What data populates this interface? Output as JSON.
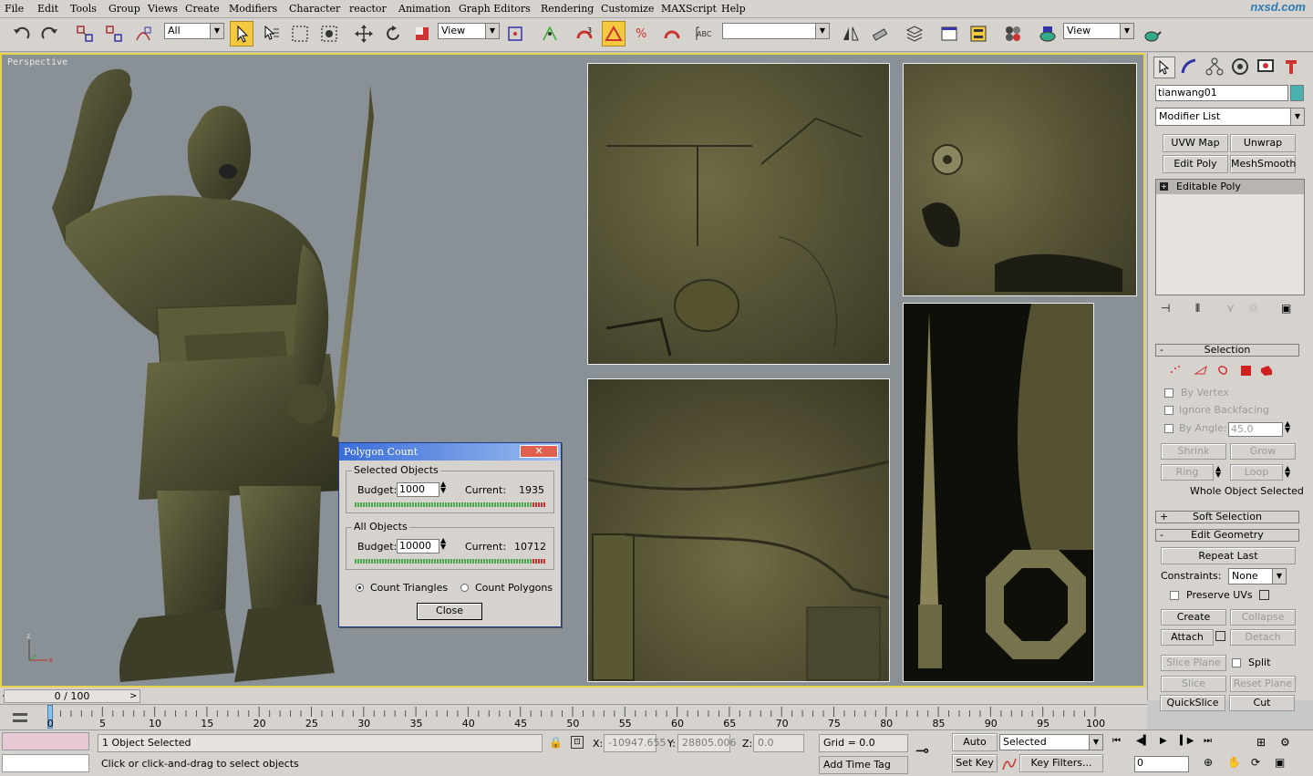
{
  "menu": [
    "File",
    "Edit",
    "Tools",
    "Group",
    "Views",
    "Create",
    "Modifiers",
    "Character",
    "reactor",
    "Animation",
    "Graph Editors",
    "Rendering",
    "Customize",
    "MAXScript",
    "Help"
  ],
  "logo": "nxsd.com",
  "toolbar": {
    "selection_filter": "All",
    "ref_coord": "View",
    "named_selection": "",
    "render_view": "View"
  },
  "viewport": {
    "label": "Perspective",
    "axis_x": "x",
    "axis_z": "z"
  },
  "polygon_dialog": {
    "title": "Polygon Count",
    "close_x": "✕",
    "selected": {
      "title": "Selected Objects",
      "budget_label": "Budget:",
      "budget": "1000",
      "current_label": "Current:",
      "current": "1935"
    },
    "all": {
      "title": "All Objects",
      "budget_label": "Budget:",
      "budget": "10000",
      "current_label": "Current:",
      "current": "10712"
    },
    "count_triangles": "Count Triangles",
    "count_polygons": "Count Polygons",
    "close_button": "Close"
  },
  "panel": {
    "object_name": "tianwang01",
    "modifier_list": "Modifier List",
    "mod_buttons": [
      "UVW Map",
      "Unwrap UVW",
      "Edit Poly",
      "MeshSmooth"
    ],
    "stack_item": "Editable Poly",
    "selection_title": "Selection",
    "by_vertex": "By Vertex",
    "ignore_backfacing": "Ignore Backfacing",
    "by_angle": "By Angle:",
    "angle_value": "45.0",
    "shrink": "Shrink",
    "grow": "Grow",
    "ring": "Ring",
    "loop": "Loop",
    "whole_object": "Whole Object Selected",
    "soft_selection": "Soft Selection",
    "edit_geometry": "Edit Geometry",
    "repeat_last": "Repeat Last",
    "constraints": "Constraints:",
    "constraints_value": "None",
    "preserve_uvs": "Preserve UVs",
    "create": "Create",
    "collapse": "Collapse",
    "attach": "Attach",
    "detach": "Detach",
    "slice_plane": "Slice Plane",
    "split": "Split",
    "slice": "Slice",
    "reset_plane": "Reset Plane",
    "quickslice": "QuickSlice",
    "cut": "Cut"
  },
  "timeline": {
    "slider": "0 / 100",
    "ticks": [
      "0",
      "5",
      "10",
      "15",
      "20",
      "25",
      "30",
      "35",
      "40",
      "45",
      "50",
      "55",
      "60",
      "65",
      "70",
      "75",
      "80",
      "85",
      "90",
      "95",
      "100"
    ]
  },
  "status": {
    "objects_selected": "1 Object Selected",
    "prompt": "Click or click-and-drag to select objects",
    "x_label": "X:",
    "x_value": "-10947.655",
    "y_label": "Y:",
    "y_value": "28805.006",
    "z_label": "Z:",
    "z_value": "0.0",
    "grid": "Grid = 0.0",
    "add_time_tag": "Add Time Tag",
    "auto_key": "Auto Key",
    "set_key": "Set Key",
    "key_mode": "Selected",
    "key_filters": "Key Filters...",
    "frame": "0"
  },
  "colors": {
    "viewport_bg": "#8a9196",
    "active_border": "#e8d44a",
    "title_bar": "#3a6ed8"
  }
}
